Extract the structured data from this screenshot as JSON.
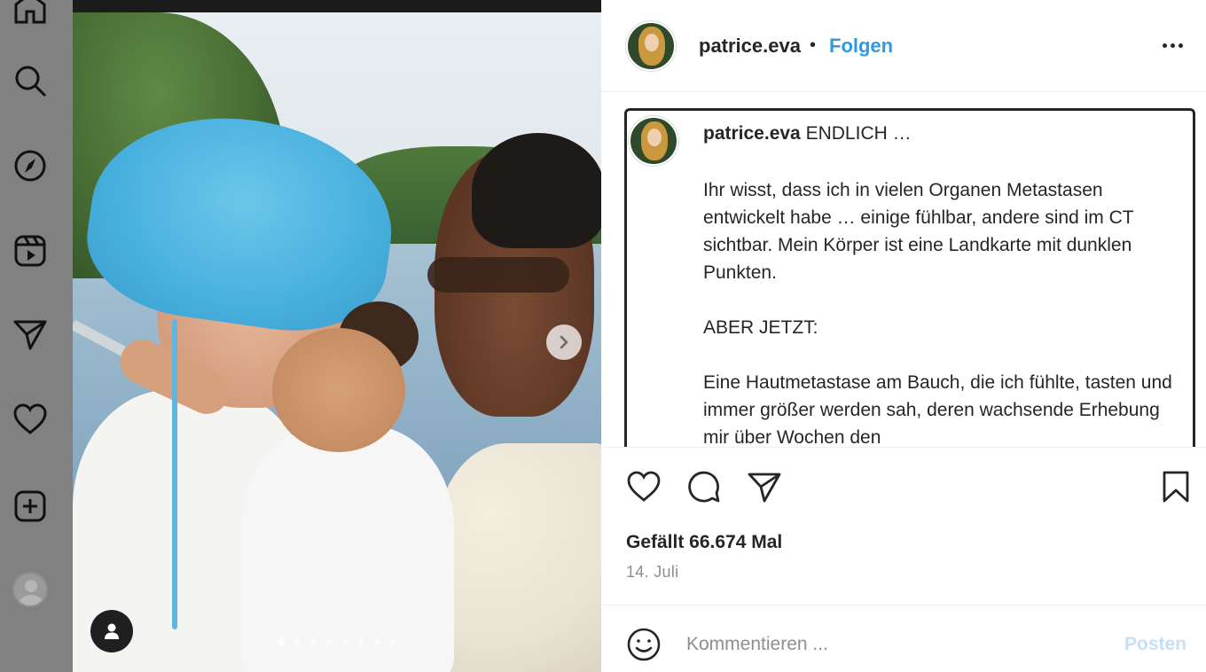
{
  "nav": {
    "items": [
      "home-icon",
      "search-icon",
      "explore-icon",
      "reels-icon",
      "direct-icon",
      "notifications-icon",
      "create-icon",
      "profile-avatar"
    ]
  },
  "post": {
    "media_dots": 8,
    "active_dot": 0
  },
  "header": {
    "username": "patrice.eva",
    "separator": "•",
    "follow_label": "Folgen"
  },
  "caption": {
    "username": "patrice.eva",
    "lead": "ENDLICH …",
    "paragraphs": [
      "Ihr wisst, dass ich in vielen Organen Metastasen entwickelt habe … einige fühlbar, andere sind im CT sichtbar. Mein Körper ist eine Landkarte mit dunklen Punkten.",
      "ABER JETZT:",
      "Eine Hautmetastase am Bauch, die ich fühlte, tasten und immer größer werden sah, deren wachsende Erhebung mir über Wochen den"
    ]
  },
  "engagement": {
    "likes": "Gefällt 66.674 Mal",
    "date": "14. Juli"
  },
  "comment": {
    "placeholder": "Kommentieren ...",
    "post_label": "Posten"
  },
  "colors": {
    "accent": "#2c9ae3",
    "post_disabled": "#c4e0f7",
    "text": "#262626",
    "muted": "#8e8e8e"
  }
}
